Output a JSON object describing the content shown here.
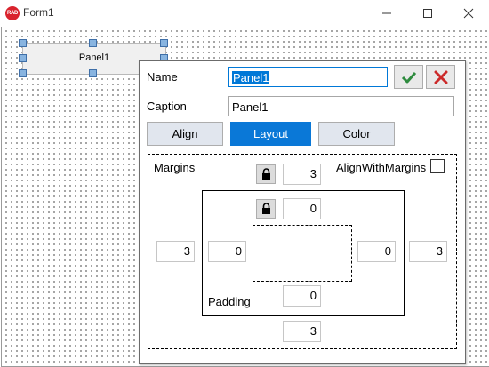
{
  "window": {
    "title": "Form1",
    "icon_text": "RAD"
  },
  "form": {
    "panel_caption": "Panel1"
  },
  "popup": {
    "name_label": "Name",
    "name_value": "Panel1",
    "caption_label": "Caption",
    "caption_value": "Panel1",
    "tabs": [
      {
        "label": "Align",
        "active": false
      },
      {
        "label": "Layout",
        "active": true
      },
      {
        "label": "Color",
        "active": false
      }
    ],
    "margins_label": "Margins",
    "align_with_margins_label": "AlignWithMargins",
    "align_with_margins_checked": false,
    "margins": {
      "top": "3",
      "left": "3",
      "right": "3",
      "bottom": "3"
    },
    "padding_label": "Padding",
    "padding": {
      "top": "0",
      "left": "0",
      "right": "0",
      "bottom": "0"
    }
  },
  "colors": {
    "accent": "#0078d7",
    "ok_green": "#2e8b3e",
    "cancel_red": "#cc2a2a"
  }
}
